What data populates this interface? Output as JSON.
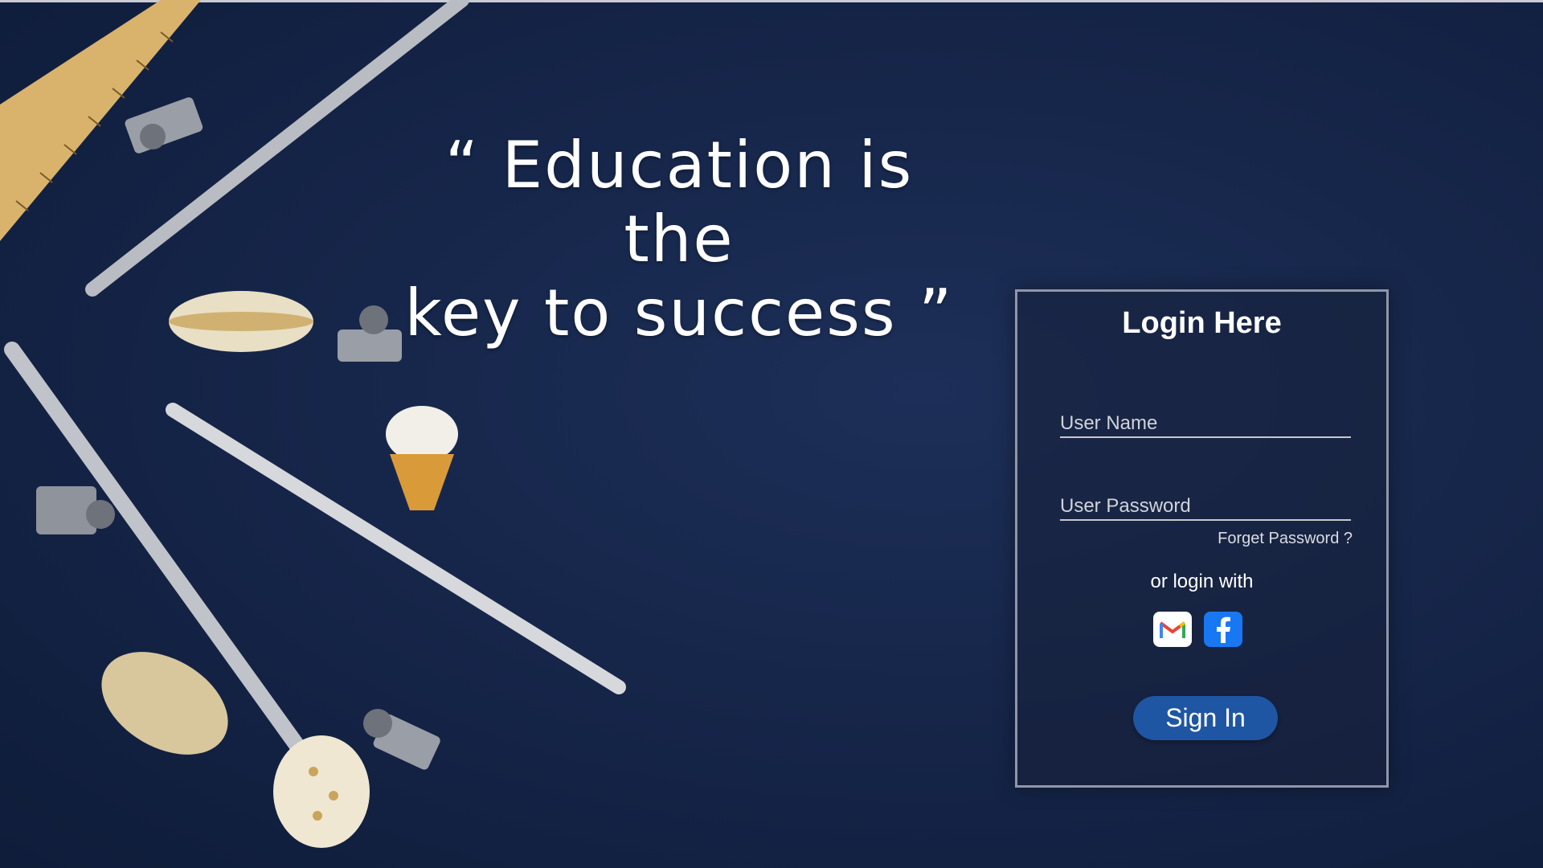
{
  "quote": {
    "line1": "“ Education is the",
    "line2": "key to success ”"
  },
  "login": {
    "title": "Login Here",
    "username_placeholder": "User Name",
    "password_placeholder": "User Password",
    "forgot_label": "Forget Password ?",
    "alt_login_label": "or login with",
    "social_icons": [
      "gmail-icon",
      "facebook-icon"
    ],
    "signin_label": "Sign In"
  },
  "colors": {
    "background": "#16264a",
    "accent_button": "#1f56a3",
    "facebook": "#1877f2"
  }
}
